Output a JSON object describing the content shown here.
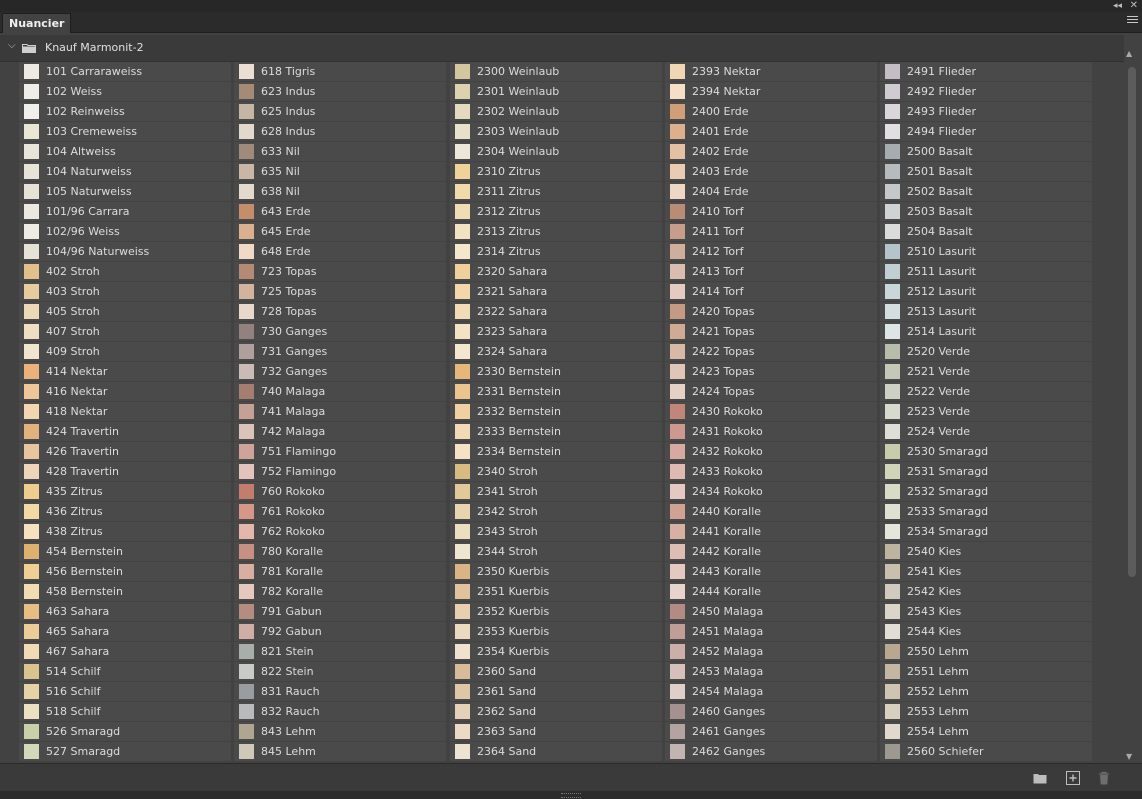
{
  "window": {
    "collapse_icon": "double-chevron-left-icon",
    "close_icon": "close-icon",
    "collapse_glyph": "◂◂",
    "close_glyph": "✕"
  },
  "tabs": [
    {
      "label": "Nuancier",
      "active": true
    }
  ],
  "panel_menu_icon": "hamburger-menu-icon",
  "group": {
    "name": "Knauf Marmonit-2",
    "expanded": true,
    "chevron": "⌵"
  },
  "columns": [
    [
      {
        "label": "101 Carraraweiss",
        "color": "#eeeae1"
      },
      {
        "label": "102 Weiss",
        "color": "#efede8"
      },
      {
        "label": "102 Reinweiss",
        "color": "#f0efe9"
      },
      {
        "label": "103 Cremeweiss",
        "color": "#ebe5d5"
      },
      {
        "label": "104 Altweiss",
        "color": "#e9e4d8"
      },
      {
        "label": "104 Naturweiss",
        "color": "#e8e3d7"
      },
      {
        "label": "105 Naturweiss",
        "color": "#e7e2d5"
      },
      {
        "label": "101/96 Carrara",
        "color": "#ece8df"
      },
      {
        "label": "102/96 Weiss",
        "color": "#eeebe4"
      },
      {
        "label": "104/96 Naturweiss",
        "color": "#e7e2d6"
      },
      {
        "label": "402 Stroh",
        "color": "#e2c08c"
      },
      {
        "label": "403 Stroh",
        "color": "#e6cb9e"
      },
      {
        "label": "405 Stroh",
        "color": "#ecd8b4"
      },
      {
        "label": "407 Stroh",
        "color": "#eedfc3"
      },
      {
        "label": "409 Stroh",
        "color": "#f0e5d0"
      },
      {
        "label": "414 Nektar",
        "color": "#eab27a"
      },
      {
        "label": "416 Nektar",
        "color": "#efc796"
      },
      {
        "label": "418 Nektar",
        "color": "#f2d6b2"
      },
      {
        "label": "424 Travertin",
        "color": "#e1b17e"
      },
      {
        "label": "426 Travertin",
        "color": "#e8c59c"
      },
      {
        "label": "428 Travertin",
        "color": "#eed5b8"
      },
      {
        "label": "435 Zitrus",
        "color": "#efcd8e"
      },
      {
        "label": "436 Zitrus",
        "color": "#f2d9a6"
      },
      {
        "label": "438 Zitrus",
        "color": "#f3e2bd"
      },
      {
        "label": "454 Bernstein",
        "color": "#ddb26e"
      },
      {
        "label": "456 Bernstein",
        "color": "#f0cf94"
      },
      {
        "label": "458 Bernstein",
        "color": "#f2dcb1"
      },
      {
        "label": "463 Sahara",
        "color": "#e5be83"
      },
      {
        "label": "465 Sahara",
        "color": "#eccd98"
      },
      {
        "label": "467 Sahara",
        "color": "#efdbb6"
      },
      {
        "label": "514 Schilf",
        "color": "#d9c48e"
      },
      {
        "label": "516 Schilf",
        "color": "#e3d3a6"
      },
      {
        "label": "518 Schilf",
        "color": "#ebe0c0"
      },
      {
        "label": "526 Smaragd",
        "color": "#c9cfa8"
      },
      {
        "label": "527 Smaragd",
        "color": "#d3d8b8"
      }
    ],
    [
      {
        "label": "618 Tigris",
        "color": "#eadfd2"
      },
      {
        "label": "623 Indus",
        "color": "#a58a76"
      },
      {
        "label": "625 Indus",
        "color": "#c7b5a3"
      },
      {
        "label": "628 Indus",
        "color": "#e2d8cb"
      },
      {
        "label": "633 Nil",
        "color": "#a08a79"
      },
      {
        "label": "635 Nil",
        "color": "#c9b6a6"
      },
      {
        "label": "638 Nil",
        "color": "#e4d9cd"
      },
      {
        "label": "643 Erde",
        "color": "#c48e69"
      },
      {
        "label": "645 Erde",
        "color": "#dbb08f"
      },
      {
        "label": "648 Erde",
        "color": "#f0dac6"
      },
      {
        "label": "723 Topas",
        "color": "#b58a73"
      },
      {
        "label": "725 Topas",
        "color": "#d3b29e"
      },
      {
        "label": "728 Topas",
        "color": "#e8d8cc"
      },
      {
        "label": "730 Ganges",
        "color": "#938180"
      },
      {
        "label": "731 Ganges",
        "color": "#b09f9c"
      },
      {
        "label": "732 Ganges",
        "color": "#cbbbb6"
      },
      {
        "label": "740 Malaga",
        "color": "#a57e70"
      },
      {
        "label": "741 Malaga",
        "color": "#c5a095"
      },
      {
        "label": "742 Malaga",
        "color": "#dcc3ba"
      },
      {
        "label": "751 Flamingo",
        "color": "#cfa39a"
      },
      {
        "label": "752 Flamingo",
        "color": "#e2c4bc"
      },
      {
        "label": "760 Rokoko",
        "color": "#c47c6b"
      },
      {
        "label": "761 Rokoko",
        "color": "#d69786"
      },
      {
        "label": "762 Rokoko",
        "color": "#e5b7aa"
      },
      {
        "label": "780 Koralle",
        "color": "#c79182"
      },
      {
        "label": "781 Koralle",
        "color": "#d9aea1"
      },
      {
        "label": "782 Koralle",
        "color": "#e6c8be"
      },
      {
        "label": "791 Gabun",
        "color": "#b48c80"
      },
      {
        "label": "792 Gabun",
        "color": "#cfaea5"
      },
      {
        "label": "821 Stein",
        "color": "#a9aeaa"
      },
      {
        "label": "822 Stein",
        "color": "#c9cbc8"
      },
      {
        "label": "831 Rauch",
        "color": "#9a9d9f"
      },
      {
        "label": "832 Rauch",
        "color": "#b8babb"
      },
      {
        "label": "843 Lehm",
        "color": "#b0a592"
      },
      {
        "label": "845 Lehm",
        "color": "#d0c8b8"
      }
    ],
    [
      {
        "label": "2300 Weinlaub",
        "color": "#d4c79e"
      },
      {
        "label": "2301 Weinlaub",
        "color": "#ddd2b0"
      },
      {
        "label": "2302 Weinlaub",
        "color": "#e3dac0"
      },
      {
        "label": "2303 Weinlaub",
        "color": "#e7e0cb"
      },
      {
        "label": "2304 Weinlaub",
        "color": "#ece7d8"
      },
      {
        "label": "2310 Zitrus",
        "color": "#eed29a"
      },
      {
        "label": "2311 Zitrus",
        "color": "#f0d9aa"
      },
      {
        "label": "2312 Zitrus",
        "color": "#f1ddb5"
      },
      {
        "label": "2313 Zitrus",
        "color": "#f2e2c0"
      },
      {
        "label": "2314 Zitrus",
        "color": "#f3e7cc"
      },
      {
        "label": "2320 Sahara",
        "color": "#efcf9a"
      },
      {
        "label": "2321 Sahara",
        "color": "#f1d7aa"
      },
      {
        "label": "2322 Sahara",
        "color": "#f2dcb6"
      },
      {
        "label": "2323 Sahara",
        "color": "#f3e2c3"
      },
      {
        "label": "2324 Sahara",
        "color": "#f4e7cf"
      },
      {
        "label": "2330 Bernstein",
        "color": "#e6b77a"
      },
      {
        "label": "2331 Bernstein",
        "color": "#ecc48e"
      },
      {
        "label": "2332 Bernstein",
        "color": "#f0d0a3"
      },
      {
        "label": "2333 Bernstein",
        "color": "#f2dab6"
      },
      {
        "label": "2334 Bernstein",
        "color": "#f3e2c6"
      },
      {
        "label": "2340 Stroh",
        "color": "#d8bb80"
      },
      {
        "label": "2341 Stroh",
        "color": "#e2c999"
      },
      {
        "label": "2342 Stroh",
        "color": "#e8d5af"
      },
      {
        "label": "2343 Stroh",
        "color": "#ecdec0"
      },
      {
        "label": "2344 Stroh",
        "color": "#efe5d0"
      },
      {
        "label": "2350 Kuerbis",
        "color": "#d9b485"
      },
      {
        "label": "2351 Kuerbis",
        "color": "#e1c29c"
      },
      {
        "label": "2352 Kuerbis",
        "color": "#e7cfb0"
      },
      {
        "label": "2353 Kuerbis",
        "color": "#ebd9c0"
      },
      {
        "label": "2354 Kuerbis",
        "color": "#efe2cf"
      },
      {
        "label": "2360 Sand",
        "color": "#d8bb98"
      },
      {
        "label": "2361 Sand",
        "color": "#dfc6a7"
      },
      {
        "label": "2362 Sand",
        "color": "#e5d1b8"
      },
      {
        "label": "2363 Sand",
        "color": "#eadac6"
      },
      {
        "label": "2364 Sand",
        "color": "#eee2d3"
      }
    ],
    [
      {
        "label": "2393 Nektar",
        "color": "#f1d6b3"
      },
      {
        "label": "2394 Nektar",
        "color": "#f3e0c6"
      },
      {
        "label": "2400 Erde",
        "color": "#d19f77"
      },
      {
        "label": "2401 Erde",
        "color": "#dcb08d"
      },
      {
        "label": "2402 Erde",
        "color": "#e4c1a3"
      },
      {
        "label": "2403 Erde",
        "color": "#e9ccb3"
      },
      {
        "label": "2404 Erde",
        "color": "#eed7c4"
      },
      {
        "label": "2410 Torf",
        "color": "#b98c76"
      },
      {
        "label": "2411 Torf",
        "color": "#c59d89"
      },
      {
        "label": "2412 Torf",
        "color": "#d0ae9c"
      },
      {
        "label": "2413 Torf",
        "color": "#dabdae"
      },
      {
        "label": "2414 Torf",
        "color": "#e3cbbf"
      },
      {
        "label": "2420 Topas",
        "color": "#c49a82"
      },
      {
        "label": "2421 Topas",
        "color": "#cfab95"
      },
      {
        "label": "2422 Topas",
        "color": "#d8b9a6"
      },
      {
        "label": "2423 Topas",
        "color": "#dfc6b6"
      },
      {
        "label": "2424 Topas",
        "color": "#e6d2c5"
      },
      {
        "label": "2430 Rokoko",
        "color": "#c2857a"
      },
      {
        "label": "2431 Rokoko",
        "color": "#cd988d"
      },
      {
        "label": "2432 Rokoko",
        "color": "#d6aaa0"
      },
      {
        "label": "2433 Rokoko",
        "color": "#debab1"
      },
      {
        "label": "2434 Rokoko",
        "color": "#e5c8c1"
      },
      {
        "label": "2440 Koralle",
        "color": "#cfa294"
      },
      {
        "label": "2441 Koralle",
        "color": "#d7b0a4"
      },
      {
        "label": "2442 Koralle",
        "color": "#debdb2"
      },
      {
        "label": "2443 Koralle",
        "color": "#e4c9c0"
      },
      {
        "label": "2444 Koralle",
        "color": "#e9d4cd"
      },
      {
        "label": "2450 Malaga",
        "color": "#b38b82"
      },
      {
        "label": "2451 Malaga",
        "color": "#c09d95"
      },
      {
        "label": "2452 Malaga",
        "color": "#ccafa8"
      },
      {
        "label": "2453 Malaga",
        "color": "#d7c0ba"
      },
      {
        "label": "2454 Malaga",
        "color": "#e0cec9"
      },
      {
        "label": "2460 Ganges",
        "color": "#a49190"
      },
      {
        "label": "2461 Ganges",
        "color": "#b4a3a1"
      },
      {
        "label": "2462 Ganges",
        "color": "#c3b4b2"
      }
    ],
    [
      {
        "label": "2491 Flieder",
        "color": "#c4bec4"
      },
      {
        "label": "2492 Flieder",
        "color": "#d0cbd0"
      },
      {
        "label": "2493 Flieder",
        "color": "#dad6da"
      },
      {
        "label": "2494 Flieder",
        "color": "#e2dfe2"
      },
      {
        "label": "2500 Basalt",
        "color": "#a6acb0"
      },
      {
        "label": "2501 Basalt",
        "color": "#b6bbbe"
      },
      {
        "label": "2502 Basalt",
        "color": "#c4c8ca"
      },
      {
        "label": "2503 Basalt",
        "color": "#d0d3d4"
      },
      {
        "label": "2504 Basalt",
        "color": "#dadcdc"
      },
      {
        "label": "2510 Lasurit",
        "color": "#b3c5cb"
      },
      {
        "label": "2511 Lasurit",
        "color": "#bfcfd3"
      },
      {
        "label": "2512 Lasurit",
        "color": "#cad7da"
      },
      {
        "label": "2513 Lasurit",
        "color": "#d4dee0"
      },
      {
        "label": "2514 Lasurit",
        "color": "#dde5e6"
      },
      {
        "label": "2520 Verde",
        "color": "#b7bdaa"
      },
      {
        "label": "2521 Verde",
        "color": "#c3c8b7"
      },
      {
        "label": "2522 Verde",
        "color": "#cdd1c3"
      },
      {
        "label": "2523 Verde",
        "color": "#d6d9ce"
      },
      {
        "label": "2524 Verde",
        "color": "#dee0d7"
      },
      {
        "label": "2530 Smaragd",
        "color": "#c7ccac"
      },
      {
        "label": "2531 Smaragd",
        "color": "#d0d4b9"
      },
      {
        "label": "2532 Smaragd",
        "color": "#d8dbc6"
      },
      {
        "label": "2533 Smaragd",
        "color": "#dfe1d1"
      },
      {
        "label": "2534 Smaragd",
        "color": "#e5e6db"
      },
      {
        "label": "2540 Kies",
        "color": "#bdb3a0"
      },
      {
        "label": "2541 Kies",
        "color": "#c8bfae"
      },
      {
        "label": "2542 Kies",
        "color": "#d2cabc"
      },
      {
        "label": "2543 Kies",
        "color": "#dbd5c9"
      },
      {
        "label": "2544 Kies",
        "color": "#e3ded5"
      },
      {
        "label": "2550 Lehm",
        "color": "#b8a892"
      },
      {
        "label": "2551 Lehm",
        "color": "#c4b6a2"
      },
      {
        "label": "2552 Lehm",
        "color": "#cfc3b2"
      },
      {
        "label": "2553 Lehm",
        "color": "#d9cfc1"
      },
      {
        "label": "2554 Lehm",
        "color": "#e1d9ce"
      },
      {
        "label": "2560 Schiefer",
        "color": "#9d9890"
      }
    ]
  ],
  "footer": {
    "icons": [
      "new-group-folder-icon",
      "new-swatch-icon",
      "delete-trash-icon"
    ]
  },
  "colors": {
    "panel_bg": "#424242",
    "cell_bg": "#4a4a4a",
    "text": "#dcdcdc"
  }
}
